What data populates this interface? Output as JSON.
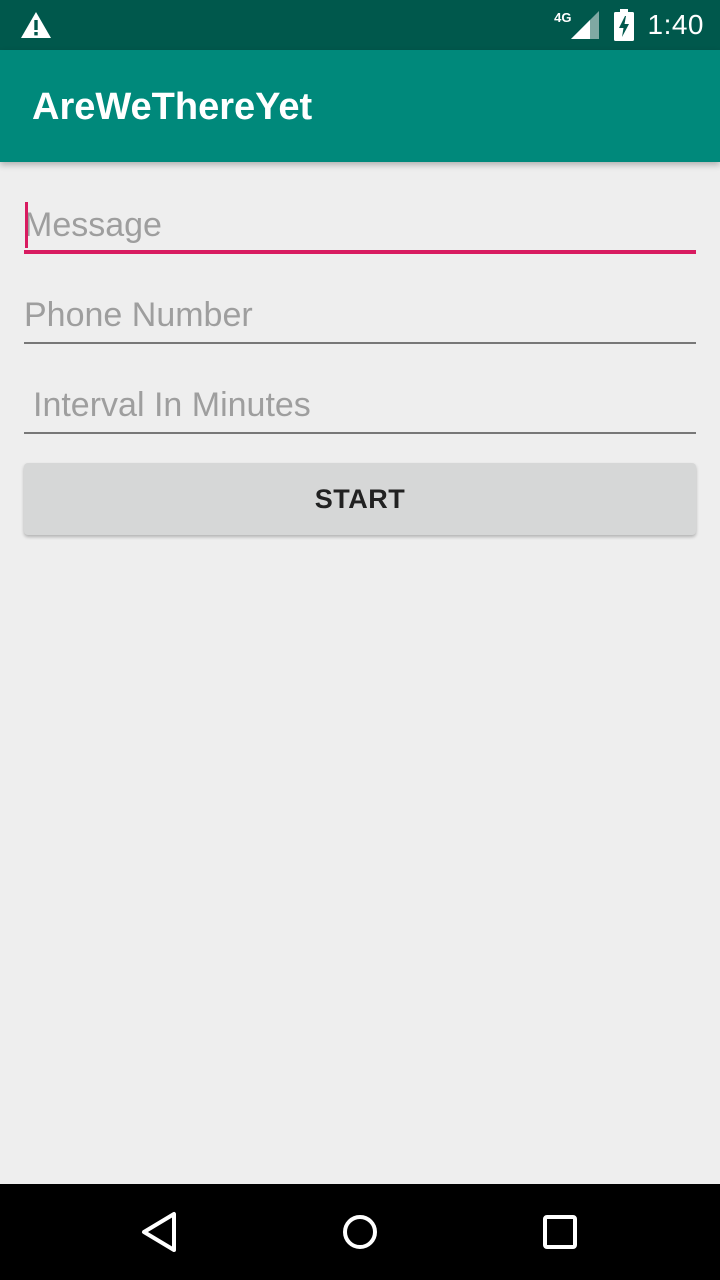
{
  "status_bar": {
    "network_type": "4G",
    "time": "1:40",
    "icons": [
      "warning-icon",
      "signal-icon",
      "battery-charging-icon"
    ]
  },
  "app_bar": {
    "title": "AreWeThereYet"
  },
  "form": {
    "message": {
      "placeholder": "Message",
      "value": ""
    },
    "phone": {
      "placeholder": "Phone Number",
      "value": ""
    },
    "interval": {
      "placeholder": "Interval In Minutes",
      "value": ""
    },
    "start_label": "START"
  },
  "colors": {
    "status_bar": "#00584c",
    "app_bar": "#00897b",
    "accent": "#d81b60",
    "background": "#eeeeee",
    "button": "#d6d7d7"
  },
  "nav_bar": {
    "icons": [
      "back-icon",
      "home-icon",
      "recents-icon"
    ]
  }
}
